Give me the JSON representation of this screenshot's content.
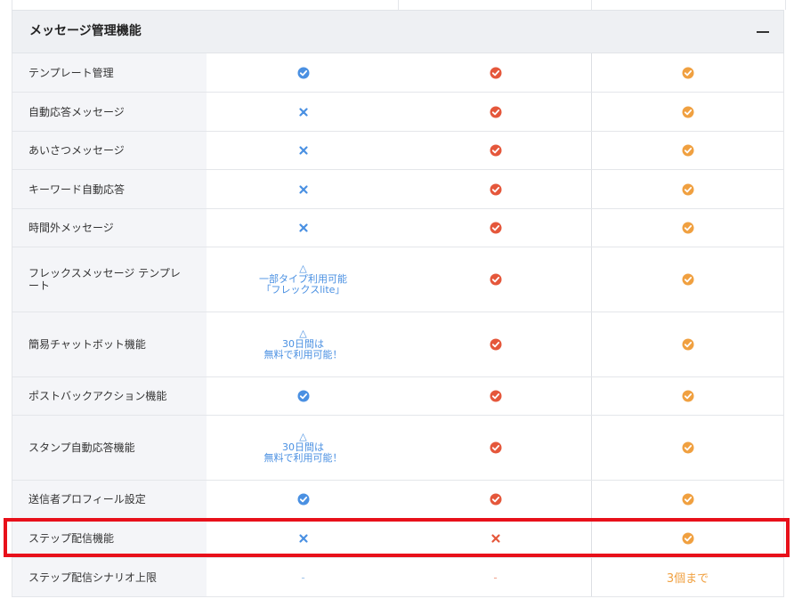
{
  "section": {
    "title": "メッセージ管理機能",
    "collapse_icon": "minus-icon"
  },
  "colors": {
    "blue": "#4a90e2",
    "red": "#e5573b",
    "orange": "#f0a040",
    "highlight": "#e8101a"
  },
  "rows": [
    {
      "label": "テンプレート管理",
      "c1": {
        "type": "check",
        "color": "blue"
      },
      "c2": {
        "type": "check",
        "color": "red"
      },
      "c3": {
        "type": "check",
        "color": "orange"
      }
    },
    {
      "label": "自動応答メッセージ",
      "c1": {
        "type": "cross",
        "color": "blue"
      },
      "c2": {
        "type": "check",
        "color": "red"
      },
      "c3": {
        "type": "check",
        "color": "orange"
      }
    },
    {
      "label": "あいさつメッセージ",
      "c1": {
        "type": "cross",
        "color": "blue"
      },
      "c2": {
        "type": "check",
        "color": "red"
      },
      "c3": {
        "type": "check",
        "color": "orange"
      }
    },
    {
      "label": "キーワード自動応答",
      "c1": {
        "type": "cross",
        "color": "blue"
      },
      "c2": {
        "type": "check",
        "color": "red"
      },
      "c3": {
        "type": "check",
        "color": "orange"
      }
    },
    {
      "label": "時間外メッセージ",
      "c1": {
        "type": "cross",
        "color": "blue"
      },
      "c2": {
        "type": "check",
        "color": "red"
      },
      "c3": {
        "type": "check",
        "color": "orange"
      }
    },
    {
      "label": "フレックスメッセージ テンプレート",
      "c1": {
        "type": "note",
        "lines": [
          "△",
          "一部タイプ利用可能",
          "「フレックスlite」"
        ]
      },
      "c2": {
        "type": "check",
        "color": "red"
      },
      "c3": {
        "type": "check",
        "color": "orange"
      }
    },
    {
      "label": "簡易チャットボット機能",
      "c1": {
        "type": "note",
        "lines": [
          "△",
          "30日間は",
          "無料で利用可能！"
        ]
      },
      "c2": {
        "type": "check",
        "color": "red"
      },
      "c3": {
        "type": "check",
        "color": "orange"
      }
    },
    {
      "label": "ポストバックアクション機能",
      "c1": {
        "type": "check",
        "color": "blue"
      },
      "c2": {
        "type": "check",
        "color": "red"
      },
      "c3": {
        "type": "check",
        "color": "orange"
      }
    },
    {
      "label": "スタンプ自動応答機能",
      "c1": {
        "type": "note",
        "lines": [
          "△",
          "30日間は",
          "無料で利用可能！"
        ]
      },
      "c2": {
        "type": "check",
        "color": "red"
      },
      "c3": {
        "type": "check",
        "color": "orange"
      }
    },
    {
      "label": "送信者プロフィール設定",
      "c1": {
        "type": "check",
        "color": "blue"
      },
      "c2": {
        "type": "check",
        "color": "red"
      },
      "c3": {
        "type": "check",
        "color": "orange"
      }
    },
    {
      "label": "ステップ配信機能",
      "c1": {
        "type": "cross",
        "color": "blue"
      },
      "c2": {
        "type": "cross",
        "color": "red"
      },
      "c3": {
        "type": "check",
        "color": "orange"
      }
    },
    {
      "label": "ステップ配信シナリオ上限",
      "c1": {
        "type": "text",
        "value": "-",
        "color": "blue"
      },
      "c2": {
        "type": "text",
        "value": "-",
        "color": "red"
      },
      "c3": {
        "type": "text",
        "value": "3個まで",
        "color": "orange"
      }
    }
  ]
}
